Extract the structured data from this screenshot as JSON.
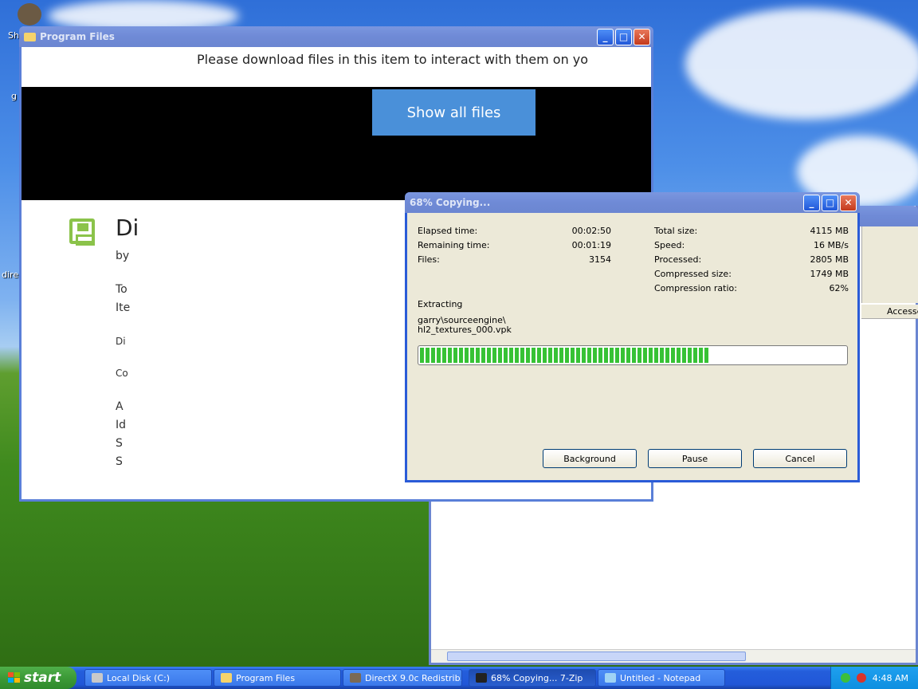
{
  "desktop": {
    "icons": [
      {
        "label": "Sh"
      },
      {
        "label": "g"
      },
      {
        "label": "dire"
      }
    ]
  },
  "program_files_window": {
    "title": "Program Files",
    "notice": "Please download files in this item to interact with them on yo",
    "show_all_files": "Show all files",
    "page_title": "Di",
    "lines": [
      "by",
      "To",
      "Ite",
      "Di",
      "Co",
      "A",
      "Id",
      "S",
      "S"
    ]
  },
  "bg_explorer": {
    "header_accessed": "Accesse"
  },
  "zip_dialog": {
    "title": "68% Copying...",
    "elapsed_label": "Elapsed time:",
    "elapsed_value": "00:02:50",
    "remaining_label": "Remaining time:",
    "remaining_value": "00:01:19",
    "files_label": "Files:",
    "files_value": "3154",
    "total_size_label": "Total size:",
    "total_size_value": "4115 MB",
    "speed_label": "Speed:",
    "speed_value": "16 MB/s",
    "processed_label": "Processed:",
    "processed_value": "2805 MB",
    "compressed_label": "Compressed size:",
    "compressed_value": "1749 MB",
    "ratio_label": "Compression ratio:",
    "ratio_value": "62%",
    "operation": "Extracting",
    "path_line1": "garry\\sourceengine\\",
    "path_line2": "hl2_textures_000.vpk",
    "progress_fraction": 0.68,
    "buttons": {
      "background": "Background",
      "pause": "Pause",
      "cancel": "Cancel"
    }
  },
  "taskbar": {
    "start_label": "start",
    "tasks": [
      {
        "label": "Local Disk (C:)",
        "icon": "drive-icon"
      },
      {
        "label": "Program Files",
        "icon": "folder-icon"
      },
      {
        "label": "DirectX 9.0c Redistrib...",
        "icon": "installer-icon"
      },
      {
        "label": "68% Copying... 7-Zip",
        "icon": "7zip-icon"
      },
      {
        "label": "Untitled - Notepad",
        "icon": "notepad-icon"
      }
    ],
    "clock": "4:48 AM"
  },
  "colors": {
    "xp_blue": "#2157d8",
    "start_green": "#3c9a37",
    "progress_green": "#37c235",
    "show_all_blue": "#4a90d9"
  }
}
